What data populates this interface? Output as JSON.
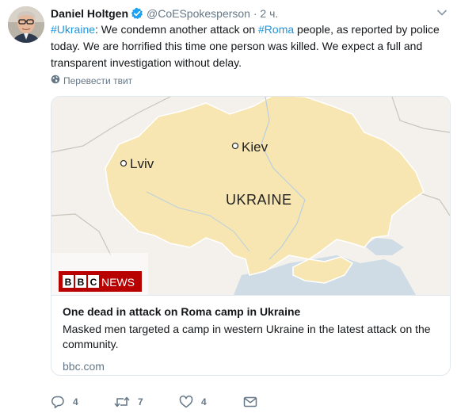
{
  "tweet": {
    "author_name": "Daniel Holtgen",
    "author_handle": "@CoESpokesperson",
    "separator": "·",
    "time": "2 ч.",
    "text_parts": {
      "tag1": "#Ukraine",
      "t1": ": We condemn another attack on ",
      "tag2": "#Roma",
      "t2": " people, as reported by police today. We are horrified this time one person was killed. We expect a full and transparent investigation without delay."
    },
    "translate_label": "Перевести твит"
  },
  "card": {
    "map_labels": {
      "kiev": "Kiev",
      "lviv": "Lviv",
      "ukraine": "UKRAINE"
    },
    "logo": {
      "bbc": "BBC",
      "news": "NEWS"
    },
    "title": "One dead in attack on Roma camp in Ukraine",
    "description": "Masked men targeted a camp in western Ukraine in the latest attack on the community.",
    "domain": "bbc.com"
  },
  "actions": {
    "reply_count": "4",
    "retweet_count": "7",
    "like_count": "4"
  },
  "icons": {
    "verified": "verified-badge-icon",
    "caret": "chevron-down-icon",
    "translate": "globe-icon",
    "reply": "reply-icon",
    "retweet": "retweet-icon",
    "like": "heart-icon",
    "message": "envelope-icon"
  },
  "colors": {
    "link": "#1b95e0",
    "secondary_text": "#657786",
    "land": "#f7e6b2",
    "water": "#cfdce6",
    "bbc_red": "#b80000"
  }
}
